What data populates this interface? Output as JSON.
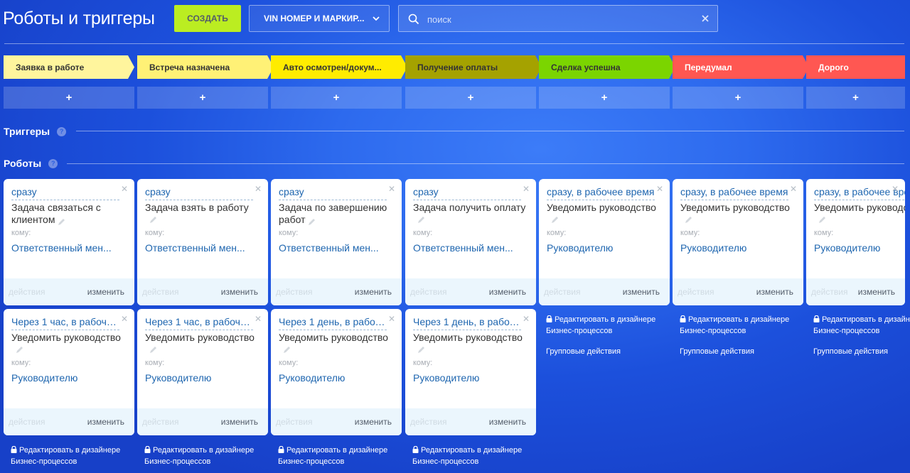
{
  "header": {
    "title": "Роботы и триггеры",
    "create_label": "СОЗДАТЬ",
    "dropdown_label": "VIN НОМЕР И МАРКИР...",
    "search_placeholder": "поиск"
  },
  "stages": [
    {
      "label": "Заявка в работе",
      "color": "#fff59d"
    },
    {
      "label": "Встреча назначена",
      "color": "#fff176"
    },
    {
      "label": "Авто осмотрен/докум...",
      "color": "#ffec00"
    },
    {
      "label": "Получение оплаты",
      "color": "#a5a200"
    },
    {
      "label": "Сделка успешна",
      "color": "#7bd500"
    },
    {
      "label": "Передумал",
      "color": "#ff5752"
    },
    {
      "label": "Дорого",
      "color": "#ff5752"
    }
  ],
  "add_label": "+",
  "sections": {
    "triggers": "Триггеры",
    "robots": "Роботы",
    "help": "?"
  },
  "cards_row1": [
    {
      "timing": "сразу",
      "name": "Задача связаться с клиентом",
      "to_label": "кому:",
      "recipient": "Ответственный мен...",
      "actions": "действия",
      "change": "изменить"
    },
    {
      "timing": "сразу",
      "name": "Задача взять в работу",
      "to_label": "кому:",
      "recipient": "Ответственный мен...",
      "actions": "действия",
      "change": "изменить"
    },
    {
      "timing": "сразу",
      "name": "Задача по завершению работ",
      "to_label": "кому:",
      "recipient": "Ответственный мен...",
      "actions": "действия",
      "change": "изменить"
    },
    {
      "timing": "сразу",
      "name": "Задача получить оплату",
      "to_label": "кому:",
      "recipient": "Ответственный мен...",
      "actions": "действия",
      "change": "изменить"
    },
    {
      "timing": "сразу, в рабочее время",
      "name": "Уведомить руководство",
      "to_label": "кому:",
      "recipient": "Руководителю",
      "actions": "действия",
      "change": "изменить"
    },
    {
      "timing": "сразу, в рабочее время",
      "name": "Уведомить руководство",
      "to_label": "кому:",
      "recipient": "Руководителю",
      "actions": "действия",
      "change": "изменить"
    },
    {
      "timing": "сразу, в рабочее время",
      "name": "Уведомить руководство",
      "to_label": "кому:",
      "recipient": "Руководителю",
      "actions": "действия",
      "change": "изменить"
    }
  ],
  "cards_row2": [
    {
      "timing": "Через 1 час, в рабоче...",
      "name": "Уведомить руководство",
      "to_label": "кому:",
      "recipient": "Руководителю",
      "actions": "действия",
      "change": "изменить"
    },
    {
      "timing": "Через 1 час, в рабоче...",
      "name": "Уведомить руководство",
      "to_label": "кому:",
      "recipient": "Руководителю",
      "actions": "действия",
      "change": "изменить"
    },
    {
      "timing": "Через 1 день, в рабоч...",
      "name": "Уведомить руководство",
      "to_label": "кому:",
      "recipient": "Руководителю",
      "actions": "действия",
      "change": "изменить"
    },
    {
      "timing": "Через 1 день, в рабоч...",
      "name": "Уведомить руководство",
      "to_label": "кому:",
      "recipient": "Руководителю",
      "actions": "действия",
      "change": "изменить"
    }
  ],
  "designer_link": {
    "line1": "Редактировать в дизайнере",
    "line2": "Бизнес-процессов"
  },
  "group_actions": "Групповые действия",
  "icons": {
    "search": "search-icon",
    "clear": "close-icon",
    "chevron": "chevron-down-icon",
    "edit": "pencil-icon",
    "lock": "lock-icon",
    "close": "close-icon"
  }
}
